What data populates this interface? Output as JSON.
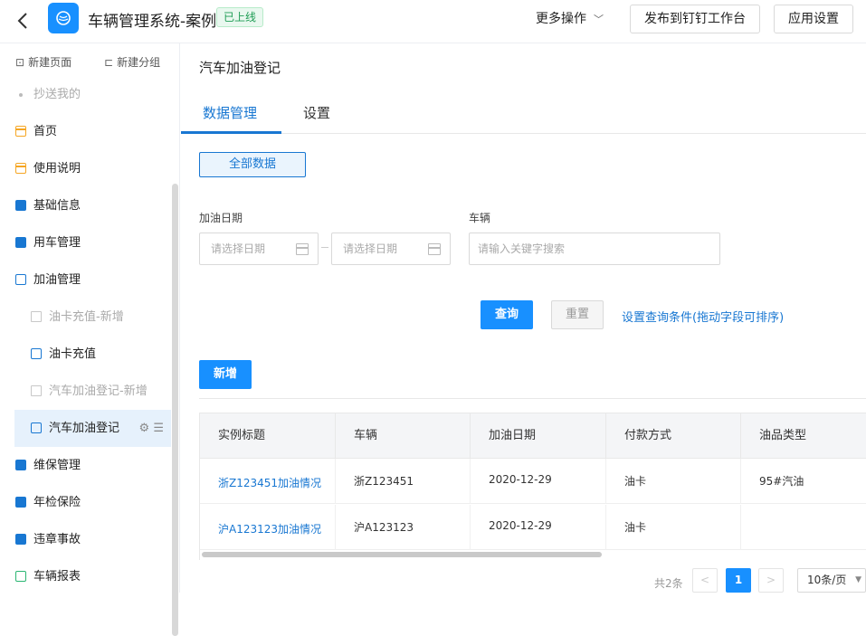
{
  "app": {
    "title": "车辆管理系统-案例",
    "status": "已上线",
    "more_ops": "更多操作",
    "publish_btn": "发布到钉钉工作台",
    "settings_btn": "应用设置"
  },
  "sidebar": {
    "new_page": "新建页面",
    "new_group": "新建分组",
    "items": [
      {
        "label": "抄送我的",
        "type": "dot",
        "dim": true
      },
      {
        "label": "首页",
        "icon": "page-icon"
      },
      {
        "label": "使用说明",
        "icon": "page-icon"
      },
      {
        "label": "基础信息",
        "icon": "folder-icon"
      },
      {
        "label": "用车管理",
        "icon": "folder-icon"
      },
      {
        "label": "加油管理",
        "icon": "folder-open-icon"
      },
      {
        "label": "油卡充值-新增",
        "icon": "doc-icon",
        "dim": true
      },
      {
        "label": "油卡充值",
        "icon": "form-icon"
      },
      {
        "label": "汽车加油登记-新增",
        "icon": "doc-icon",
        "dim": true
      },
      {
        "label": "汽车加油登记",
        "icon": "form-icon",
        "active": true
      },
      {
        "label": "维保管理",
        "icon": "folder-icon"
      },
      {
        "label": "年检保险",
        "icon": "folder-icon"
      },
      {
        "label": "违章事故",
        "icon": "folder-icon"
      },
      {
        "label": "车辆报表",
        "icon": "chart-icon"
      }
    ]
  },
  "page": {
    "title": "汽车加油登记",
    "tabs": [
      "数据管理",
      "设置"
    ],
    "all_data": "全部数据"
  },
  "filters": {
    "date_label": "加油日期",
    "date_start_placeholder": "请选择日期",
    "date_end_placeholder": "请选择日期",
    "vehicle_label": "车辆",
    "vehicle_placeholder": "请输入关键字搜索",
    "query_btn": "查询",
    "reset_btn": "重置",
    "settings_link": "设置查询条件(拖动字段可排序)"
  },
  "actions": {
    "add_btn": "新增"
  },
  "table": {
    "columns": [
      "实例标题",
      "车辆",
      "加油日期",
      "付款方式",
      "油品类型"
    ],
    "rows": [
      [
        "浙Z123451加油情况",
        "浙Z123451",
        "2020-12-29",
        "油卡",
        "95#汽油"
      ],
      [
        "沪A123123加油情况",
        "沪A123123",
        "2020-12-29",
        "油卡",
        ""
      ]
    ]
  },
  "pagination": {
    "total": "共2条",
    "current": "1",
    "page_size": "10条/页"
  }
}
